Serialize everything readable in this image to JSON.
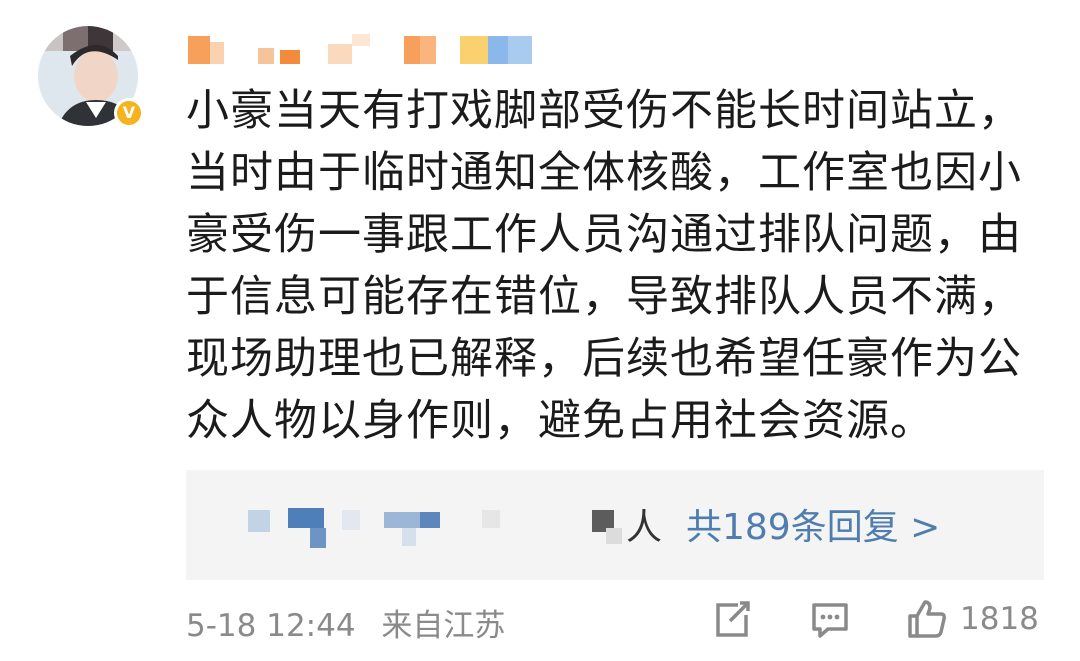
{
  "comment": {
    "lines": [
      "小豪当天有打戏脚部受伤不能长时间站立，",
      "当时由于临时通知全体核酸，工作室也因小",
      "豪受伤一事跟工作人员沟通过排队问题，由",
      "于信息可能存在错位，导致排队人员不满，",
      "现场助理也已解释，后续也希望任豪作为公",
      "众人物以身作则，避免占用社会资源。"
    ]
  },
  "replies": {
    "people_suffix": "人",
    "count_text": "共189条回复 >"
  },
  "footer": {
    "date": "5-18",
    "time": "12:44",
    "location": "来自江苏",
    "like_count": "1818"
  },
  "icons": {
    "verified": "verified-badge-icon",
    "share": "share-icon",
    "comment": "comment-icon",
    "like": "thumbs-up-icon"
  },
  "colors": {
    "text": "#1b1b1b",
    "muted": "#8a8a8a",
    "link": "#507daf",
    "reply_background": "#f4f4f4",
    "verified": "#f5b31e"
  }
}
